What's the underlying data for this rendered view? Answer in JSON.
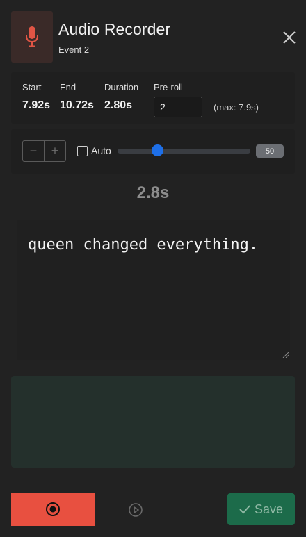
{
  "header": {
    "title": "Audio Recorder",
    "subtitle": "Event 2",
    "icon": "microphone-icon",
    "close_icon": "close-icon"
  },
  "stats": {
    "start_label": "Start",
    "start_value": "7.92s",
    "end_label": "End",
    "end_value": "10.72s",
    "duration_label": "Duration",
    "duration_value": "2.80s",
    "preroll_label": "Pre-roll",
    "preroll_value": "2",
    "preroll_max": "(max: 7.9s)"
  },
  "controls": {
    "minus_label": "−",
    "plus_label": "+",
    "auto_label": "Auto",
    "auto_checked": false,
    "slider_value": "50",
    "slider_fraction": 0.3
  },
  "duration_display": "2.8s",
  "transcript": {
    "text": "queen changed everything."
  },
  "footer": {
    "record_icon": "record-icon",
    "play_icon": "play-circle-icon",
    "save_label": "Save",
    "save_icon": "check-icon"
  },
  "colors": {
    "record": "#e85040",
    "save": "#1c6b4a",
    "accent": "#1e6fe8",
    "mic": "#e05545"
  }
}
